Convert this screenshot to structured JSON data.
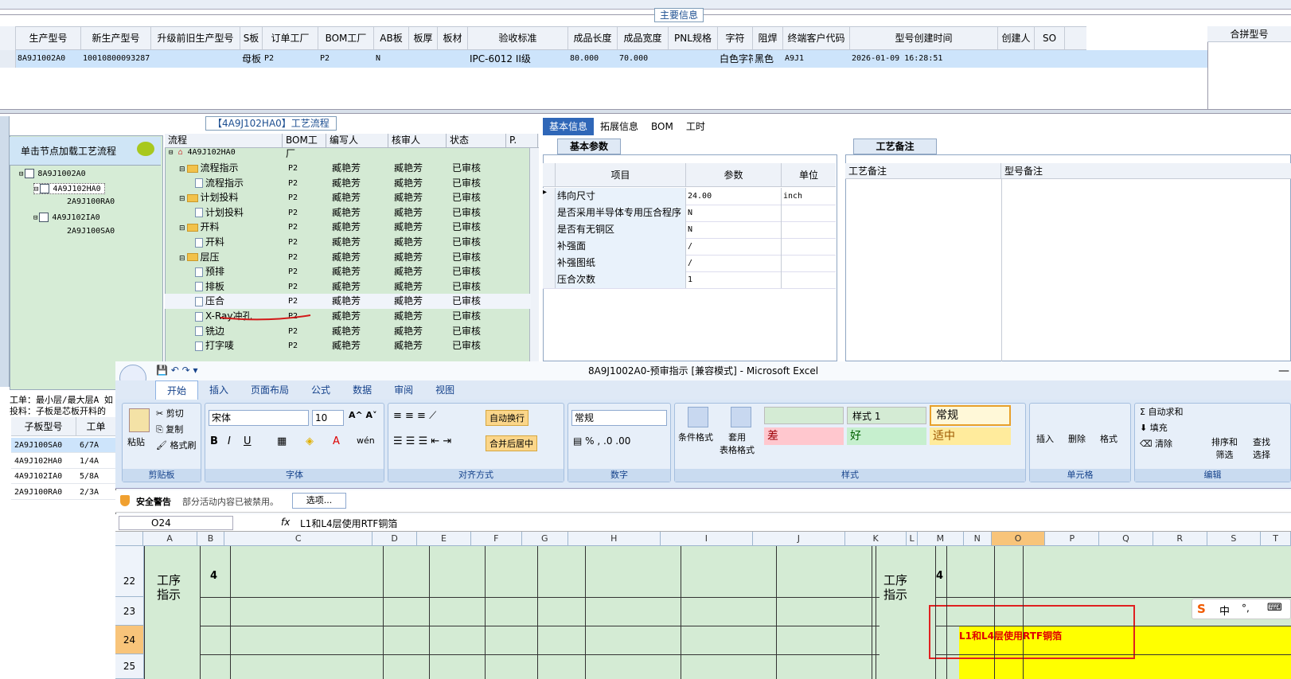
{
  "main_info": {
    "title": "主要信息",
    "merge_header": "合拼型号",
    "columns": [
      "生产型号",
      "新生产型号",
      "升级前旧生产型号",
      "S板",
      "订单工厂",
      "BOM工厂",
      "AB板",
      "板厚",
      "板材",
      "验收标准",
      "成品长度",
      "成品宽度",
      "PNL规格",
      "字符",
      "阻焊",
      "终端客户代码",
      "型号创建时间",
      "创建人",
      "SO"
    ],
    "row": [
      "8A9J1002A0",
      "10010800093287",
      "",
      "母板",
      "P2",
      "P2",
      "N",
      "",
      "",
      "IPC-6012 II级",
      "80.000",
      "70.000",
      "",
      "白色字符",
      "黑色",
      "A9J1",
      "2026-01-09 16:28:51",
      "",
      ""
    ]
  },
  "tree_panel": {
    "hint": "单击节点加载工艺流程",
    "nodes": [
      "8A9J1002A0",
      "4A9J102HA0",
      "2A9J100RA0",
      "4A9J102IA0",
      "2A9J100SA0"
    ]
  },
  "flow_panel": {
    "title": "【4A9J102HA0】工艺流程",
    "headers": [
      "流程",
      "BOM工厂",
      "编写人",
      "核审人",
      "状态",
      "P."
    ],
    "root": "4A9J102HA0",
    "rows": [
      {
        "name": "流程指示",
        "bom": "P2",
        "writer": "臧艳芳",
        "reviewer": "臧艳芳",
        "status": "已审核",
        "level": 1
      },
      {
        "name": "流程指示",
        "bom": "P2",
        "writer": "臧艳芳",
        "reviewer": "臧艳芳",
        "status": "已审核",
        "level": 2
      },
      {
        "name": "计划投料",
        "bom": "P2",
        "writer": "臧艳芳",
        "reviewer": "臧艳芳",
        "status": "已审核",
        "level": 1
      },
      {
        "name": "计划投料",
        "bom": "P2",
        "writer": "臧艳芳",
        "reviewer": "臧艳芳",
        "status": "已审核",
        "level": 2
      },
      {
        "name": "开料",
        "bom": "P2",
        "writer": "臧艳芳",
        "reviewer": "臧艳芳",
        "status": "已审核",
        "level": 1
      },
      {
        "name": "开料",
        "bom": "P2",
        "writer": "臧艳芳",
        "reviewer": "臧艳芳",
        "status": "已审核",
        "level": 2
      },
      {
        "name": "层压",
        "bom": "P2",
        "writer": "臧艳芳",
        "reviewer": "臧艳芳",
        "status": "已审核",
        "level": 1
      },
      {
        "name": "预排",
        "bom": "P2",
        "writer": "臧艳芳",
        "reviewer": "臧艳芳",
        "status": "已审核",
        "level": 2
      },
      {
        "name": "排板",
        "bom": "P2",
        "writer": "臧艳芳",
        "reviewer": "臧艳芳",
        "status": "已审核",
        "level": 2
      },
      {
        "name": "压合",
        "bom": "P2",
        "writer": "臧艳芳",
        "reviewer": "臧艳芳",
        "status": "已审核",
        "level": 2
      },
      {
        "name": "X-Ray冲孔",
        "bom": "P2",
        "writer": "臧艳芳",
        "reviewer": "臧艳芳",
        "status": "已审核",
        "level": 2
      },
      {
        "name": "铣边",
        "bom": "P2",
        "writer": "臧艳芳",
        "reviewer": "臧艳芳",
        "status": "已审核",
        "level": 2
      },
      {
        "name": "打字唛",
        "bom": "P2",
        "writer": "臧艳芳",
        "reviewer": "臧艳芳",
        "status": "已审核",
        "level": 2
      }
    ]
  },
  "right_tabs": [
    "基本信息",
    "拓展信息",
    "BOM",
    "工时"
  ],
  "basic_params": {
    "title": "基本参数",
    "headers": [
      "项目",
      "参数",
      "单位"
    ],
    "rows": [
      [
        "纬向尺寸",
        "24.00",
        "inch"
      ],
      [
        "是否采用半导体专用压合程序",
        "N",
        ""
      ],
      [
        "是否有无铜区",
        "N",
        ""
      ],
      [
        "补强面",
        "/",
        ""
      ],
      [
        "补强图纸",
        "/",
        ""
      ],
      [
        "压合次数",
        "1",
        ""
      ]
    ]
  },
  "remarks": {
    "title": "工艺备注",
    "col1": "工艺备注",
    "col2": "型号备注"
  },
  "left_bottom": {
    "line1": "工单：最小层/最大层A 如",
    "line2": "投料：子板是芯板开料的",
    "headers": [
      "子板型号",
      "工单"
    ],
    "rows": [
      [
        "2A9J100SA0",
        "6/7A"
      ],
      [
        "4A9J102HA0",
        "1/4A"
      ],
      [
        "4A9J102IA0",
        "5/8A"
      ],
      [
        "2A9J100RA0",
        "2/3A"
      ]
    ]
  },
  "excel": {
    "title": "8A9J1002A0-预审指示 [兼容模式] - Microsoft Excel",
    "tabs": [
      "开始",
      "插入",
      "页面布局",
      "公式",
      "数据",
      "审阅",
      "视图"
    ],
    "clipboard": {
      "paste": "粘贴",
      "cut": "剪切",
      "copy": "复制",
      "format": "格式刷",
      "label": "剪贴板"
    },
    "font": {
      "name": "宋体",
      "size": "10",
      "label": "字体"
    },
    "align": {
      "wrap": "自动换行",
      "merge": "合并后居中",
      "label": "对齐方式"
    },
    "number": {
      "format": "常规",
      "label": "数字"
    },
    "styles": {
      "cond": "条件格式",
      "table": "套用\n表格格式",
      "s1": "样式 1",
      "normal": "常规",
      "bad": "差",
      "good": "好",
      "neutral": "适中",
      "label": "样式"
    },
    "cells": {
      "insert": "插入",
      "delete": "删除",
      "format": "格式",
      "label": "单元格"
    },
    "edit": {
      "sum": "自动求和",
      "fill": "填充",
      "clear": "清除",
      "sort": "排序和\n筛选",
      "find": "查找\n选择",
      "label": "编辑"
    },
    "security": {
      "title": "安全警告",
      "msg": "部分活动内容已被禁用。",
      "btn": "选项..."
    },
    "namebox": "O24",
    "formula": "L1和L4层使用RTF铜箔",
    "columns": [
      "A",
      "B",
      "C",
      "D",
      "E",
      "F",
      "G",
      "H",
      "I",
      "J",
      "K",
      "L",
      "M",
      "N",
      "O",
      "P",
      "Q",
      "R",
      "S",
      "T"
    ],
    "rows": [
      "22",
      "23",
      "24",
      "25"
    ],
    "cells_text": {
      "step": "工序\n指示",
      "num": "4",
      "highlight": "L1和L4层使用RTF铜箔"
    },
    "ime": [
      "中",
      "°,"
    ]
  }
}
